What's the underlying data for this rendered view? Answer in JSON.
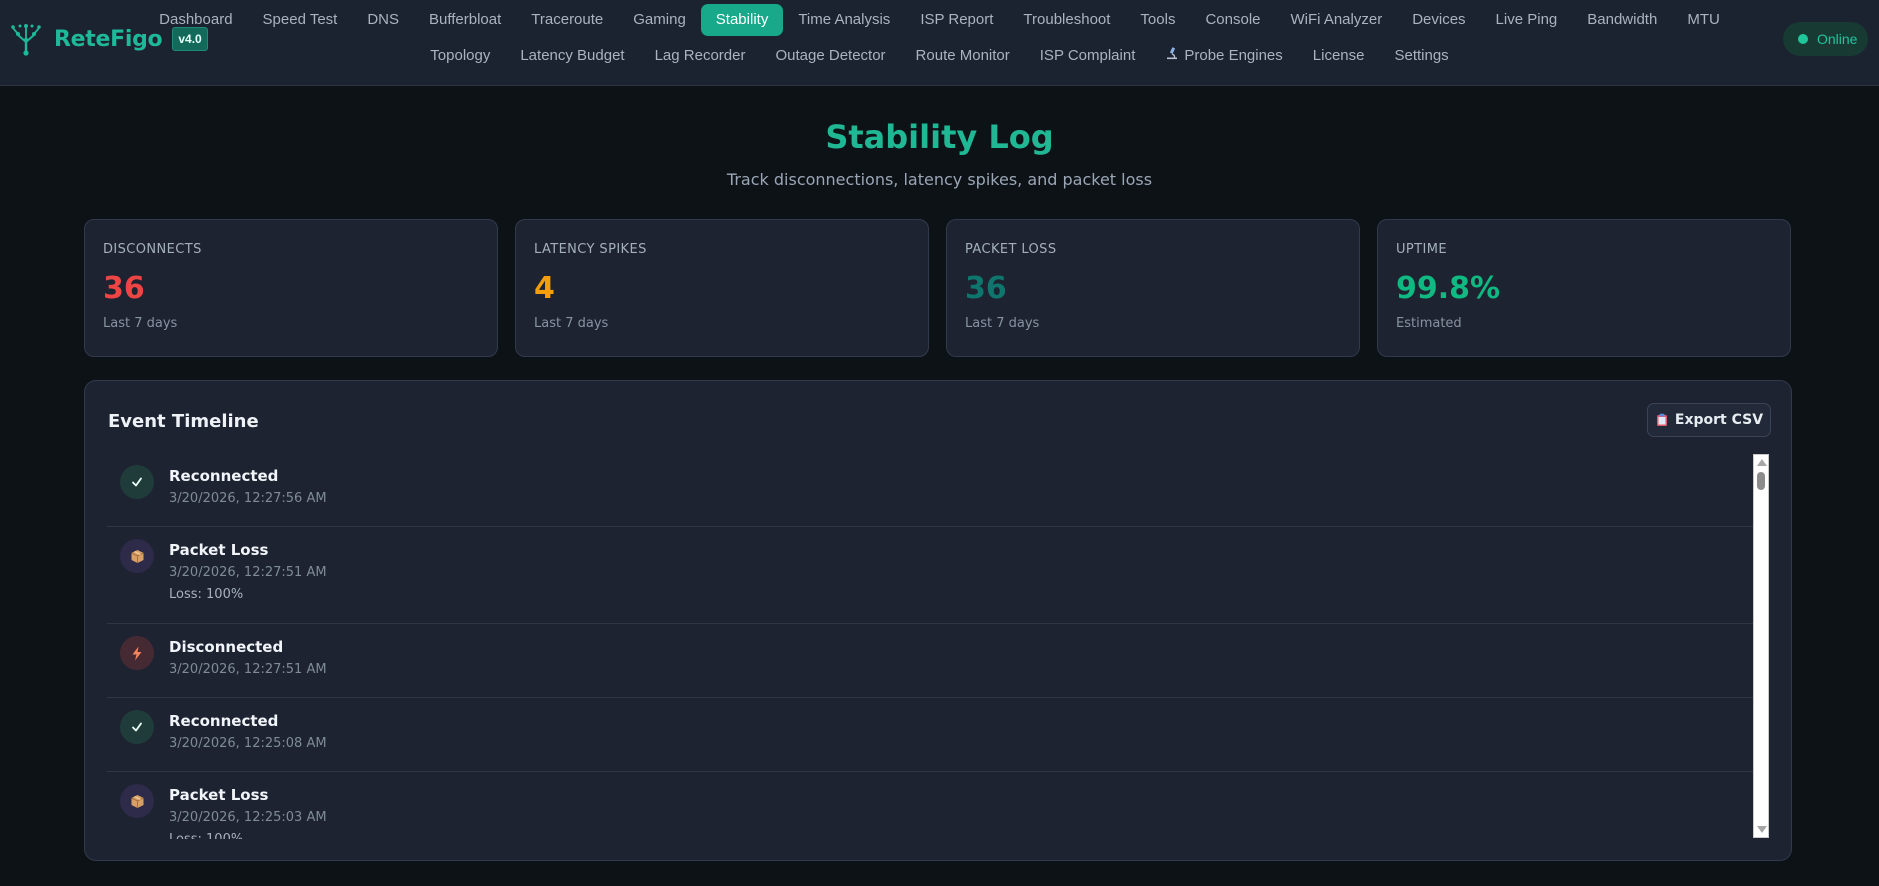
{
  "brand": {
    "name": "ReteFigo",
    "version": "v4.0"
  },
  "nav": {
    "row1": [
      "Dashboard",
      "Speed Test",
      "DNS",
      "Bufferbloat",
      "Traceroute",
      "Gaming",
      "Stability",
      "Time Analysis",
      "ISP Report",
      "Troubleshoot",
      "Tools",
      "Console",
      "WiFi Analyzer",
      "Devices",
      "Live Ping",
      "Bandwidth",
      "MTU"
    ],
    "row2": [
      "Topology",
      "Latency Budget",
      "Lag Recorder",
      "Outage Detector",
      "Route Monitor",
      "ISP Complaint",
      "Probe Engines",
      "License",
      "Settings"
    ],
    "active": "Stability"
  },
  "status": {
    "label": "Online",
    "color": "#1fc79a"
  },
  "page": {
    "title": "Stability Log",
    "subtitle": "Track disconnections, latency spikes, and packet loss"
  },
  "stats": [
    {
      "label": "DISCONNECTS",
      "value": "36",
      "foot": "Last 7 days",
      "color": "#ef4444"
    },
    {
      "label": "LATENCY SPIKES",
      "value": "4",
      "foot": "Last 7 days",
      "color": "#f59e0b"
    },
    {
      "label": "PACKET LOSS",
      "value": "36",
      "foot": "Last 7 days",
      "color": "#0f766e"
    },
    {
      "label": "UPTIME",
      "value": "99.8%",
      "foot": "Estimated",
      "color": "#10b981"
    }
  ],
  "timeline": {
    "title": "Event Timeline",
    "export_label": "Export CSV",
    "events": [
      {
        "type": "reconnected",
        "icon": "check-icon",
        "title": "Reconnected",
        "time": "3/20/2026, 12:27:56 AM",
        "detail": ""
      },
      {
        "type": "loss",
        "icon": "package-icon",
        "title": "Packet Loss",
        "time": "3/20/2026, 12:27:51 AM",
        "detail": "Loss: 100%"
      },
      {
        "type": "disc",
        "icon": "lightning-icon",
        "title": "Disconnected",
        "time": "3/20/2026, 12:27:51 AM",
        "detail": ""
      },
      {
        "type": "reconnected",
        "icon": "check-icon",
        "title": "Reconnected",
        "time": "3/20/2026, 12:25:08 AM",
        "detail": ""
      },
      {
        "type": "loss",
        "icon": "package-icon",
        "title": "Packet Loss",
        "time": "3/20/2026, 12:25:03 AM",
        "detail": "Loss: 100%"
      }
    ]
  }
}
